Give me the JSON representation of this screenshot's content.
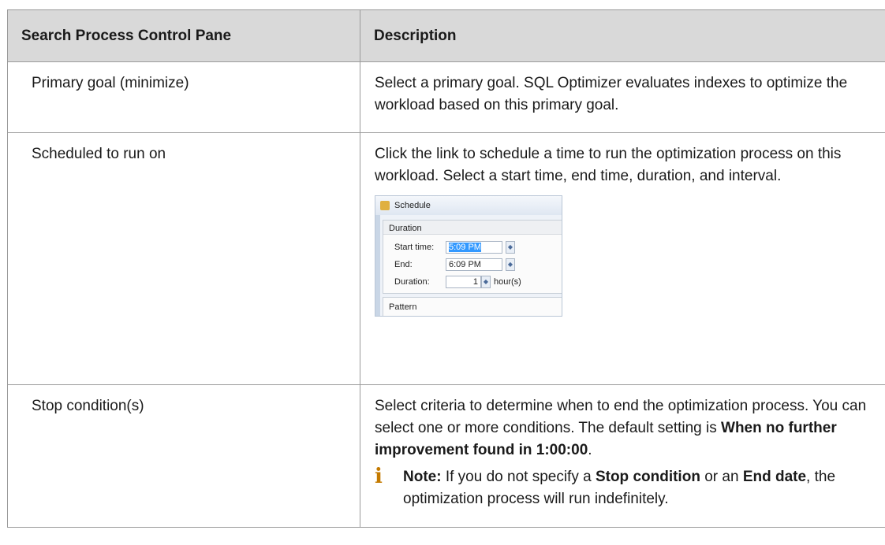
{
  "table": {
    "headers": [
      "Search Process Control Pane",
      "Description"
    ],
    "rows": [
      {
        "name": "Primary goal (minimize)",
        "desc": "Select a primary goal. SQL Optimizer evaluates indexes to optimize the workload based on this primary goal."
      },
      {
        "name": "Scheduled to run on",
        "desc": "Click the link to schedule a time to run the optimization process on this workload. Select a start time, end time, duration, and interval."
      },
      {
        "name": "Stop condition(s)",
        "desc_prefix": "Select criteria to determine when to end the optimization process. You can select one or more conditions. The default setting is ",
        "desc_bold": "When no further improvement found in 1:00:00",
        "desc_suffix": "."
      }
    ]
  },
  "schedule_dialog": {
    "title": "Schedule",
    "group": "Duration",
    "start_label": "Start time:",
    "start_value": "5:09 PM",
    "end_label": "End:",
    "end_value": "6:09 PM",
    "duration_label": "Duration:",
    "duration_value": "1",
    "duration_unit": "hour(s)",
    "pattern_label": "Pattern"
  },
  "note": {
    "label": "Note:",
    "t1": " If you do not specify a ",
    "b1": "Stop condition",
    "t2": " or an ",
    "b2": "End date",
    "t3": ", the optimization process will run indefinitely.",
    "icon": "info-icon",
    "icon_color": "#c47a00"
  },
  "colors": {
    "header_bg": "#d9d9d9",
    "border": "#9a9a9a"
  }
}
